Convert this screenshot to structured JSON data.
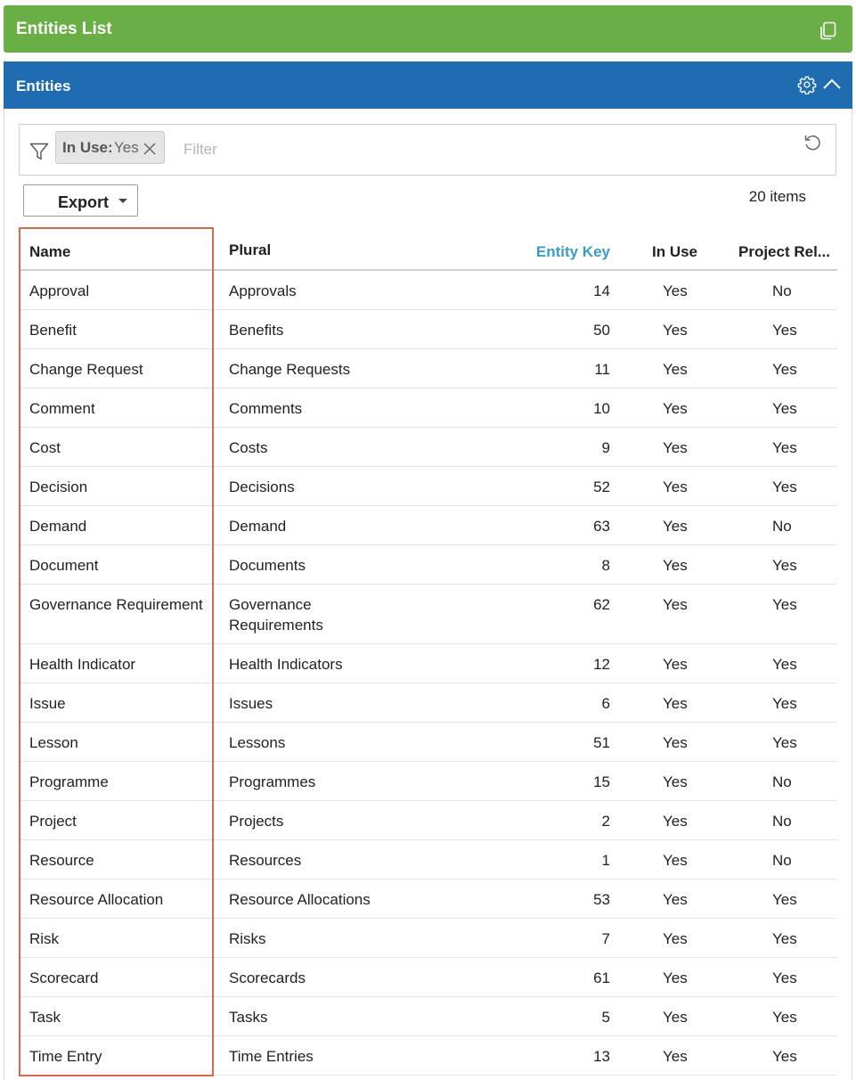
{
  "header_panel": {
    "title": "Entities List",
    "copy_icon": "copy-icon"
  },
  "section_panel": {
    "title": "Entities",
    "settings_icon": "gear-icon",
    "collapse_icon": "chevron-up-icon"
  },
  "filter": {
    "funnel_icon": "funnel-icon",
    "chip": {
      "key": "In Use:",
      "value": "Yes"
    },
    "placeholder": "Filter",
    "value": "",
    "reset_icon": "reset-icon"
  },
  "toolbar": {
    "export_label": "Export",
    "item_count": "20 items"
  },
  "colors": {
    "header_green": "#6aaf45",
    "section_blue": "#1f6db0",
    "sorted_column": "#3a9cc8",
    "highlight_border": "#d06a4c"
  },
  "table": {
    "columns": [
      "Name",
      "Plural",
      "Entity Key",
      "In Use",
      "Project Rel..."
    ],
    "rows": [
      {
        "name": "Approval",
        "plural": "Approvals",
        "key": "14",
        "in_use": "Yes",
        "project_rel": "No"
      },
      {
        "name": "Benefit",
        "plural": "Benefits",
        "key": "50",
        "in_use": "Yes",
        "project_rel": "Yes"
      },
      {
        "name": "Change Request",
        "plural": "Change Requests",
        "key": "11",
        "in_use": "Yes",
        "project_rel": "Yes"
      },
      {
        "name": "Comment",
        "plural": "Comments",
        "key": "10",
        "in_use": "Yes",
        "project_rel": "Yes"
      },
      {
        "name": "Cost",
        "plural": "Costs",
        "key": "9",
        "in_use": "Yes",
        "project_rel": "Yes"
      },
      {
        "name": "Decision",
        "plural": "Decisions",
        "key": "52",
        "in_use": "Yes",
        "project_rel": "Yes"
      },
      {
        "name": "Demand",
        "plural": "Demand",
        "key": "63",
        "in_use": "Yes",
        "project_rel": "No"
      },
      {
        "name": "Document",
        "plural": "Documents",
        "key": "8",
        "in_use": "Yes",
        "project_rel": "Yes"
      },
      {
        "name": "Governance Requirement",
        "plural": "Governance Requirements",
        "key": "62",
        "in_use": "Yes",
        "project_rel": "Yes"
      },
      {
        "name": "Health Indicator",
        "plural": "Health Indicators",
        "key": "12",
        "in_use": "Yes",
        "project_rel": "Yes"
      },
      {
        "name": "Issue",
        "plural": "Issues",
        "key": "6",
        "in_use": "Yes",
        "project_rel": "Yes"
      },
      {
        "name": "Lesson",
        "plural": "Lessons",
        "key": "51",
        "in_use": "Yes",
        "project_rel": "Yes"
      },
      {
        "name": "Programme",
        "plural": "Programmes",
        "key": "15",
        "in_use": "Yes",
        "project_rel": "No"
      },
      {
        "name": "Project",
        "plural": "Projects",
        "key": "2",
        "in_use": "Yes",
        "project_rel": "No"
      },
      {
        "name": "Resource",
        "plural": "Resources",
        "key": "1",
        "in_use": "Yes",
        "project_rel": "No"
      },
      {
        "name": "Resource Allocation",
        "plural": "Resource Allocations",
        "key": "53",
        "in_use": "Yes",
        "project_rel": "Yes"
      },
      {
        "name": "Risk",
        "plural": "Risks",
        "key": "7",
        "in_use": "Yes",
        "project_rel": "Yes"
      },
      {
        "name": "Scorecard",
        "plural": "Scorecards",
        "key": "61",
        "in_use": "Yes",
        "project_rel": "Yes"
      },
      {
        "name": "Task",
        "plural": "Tasks",
        "key": "5",
        "in_use": "Yes",
        "project_rel": "Yes"
      },
      {
        "name": "Time Entry",
        "plural": "Time Entries",
        "key": "13",
        "in_use": "Yes",
        "project_rel": "Yes"
      }
    ]
  }
}
